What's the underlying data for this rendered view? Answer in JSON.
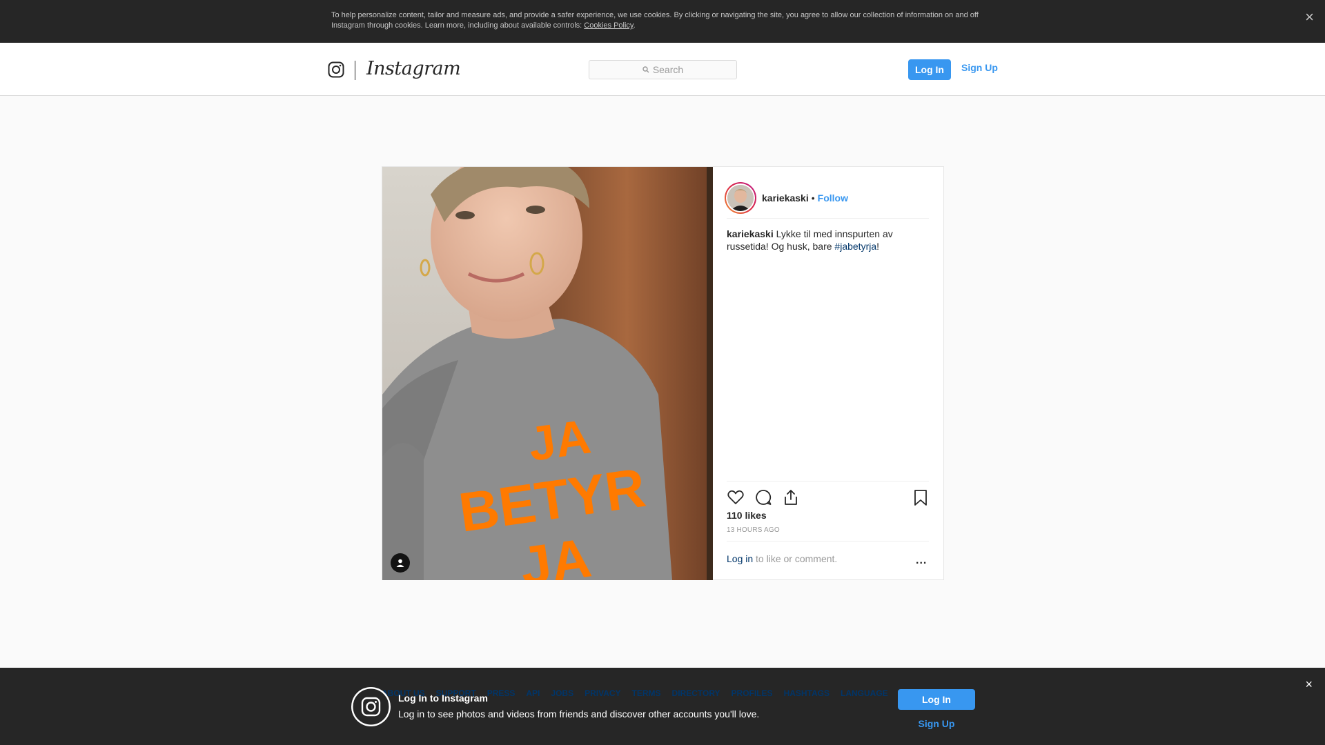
{
  "cookie_banner": {
    "text": "To help personalize content, tailor and measure ads, and provide a safer experience, we use cookies. By clicking or navigating the site, you agree to allow our collection of information on and off Instagram through cookies. Learn more, including about available controls: ",
    "link": "Cookies Policy",
    "link_suffix": ".",
    "close": "×"
  },
  "header": {
    "logo_text": "Instagram",
    "search_placeholder": "Search",
    "login": "Log In",
    "signup": "Sign Up"
  },
  "post": {
    "username": "kariekaski",
    "separator": "•",
    "follow": "Follow",
    "caption_user": "kariekaski",
    "caption_text": "Lykke til med innspurten av russetida! Og husk, bare ",
    "caption_hashtag": "#jabetyrja",
    "caption_end": "!",
    "likes": "110 likes",
    "time": "13 HOURS AGO",
    "login_link": "Log in",
    "login_text": " to like or comment.",
    "more": "...",
    "shirt_lines": [
      "JA",
      "BETYR",
      "JA"
    ]
  },
  "footer": {
    "links": [
      "ABOUT US",
      "SUPPORT",
      "PRESS",
      "API",
      "JOBS",
      "PRIVACY",
      "TERMS",
      "DIRECTORY",
      "PROFILES",
      "HASHTAGS",
      "LANGUAGE"
    ]
  },
  "login_banner": {
    "title": "Log In to Instagram",
    "subtitle": "Log in to see photos and videos from friends and discover other accounts you'll love.",
    "login": "Log In",
    "signup": "Sign Up",
    "close": "×"
  },
  "colors": {
    "accent": "#3897f0",
    "dark_bar": "#262626",
    "hashtag": "#003569",
    "shirt_text": "#ff7a00"
  }
}
